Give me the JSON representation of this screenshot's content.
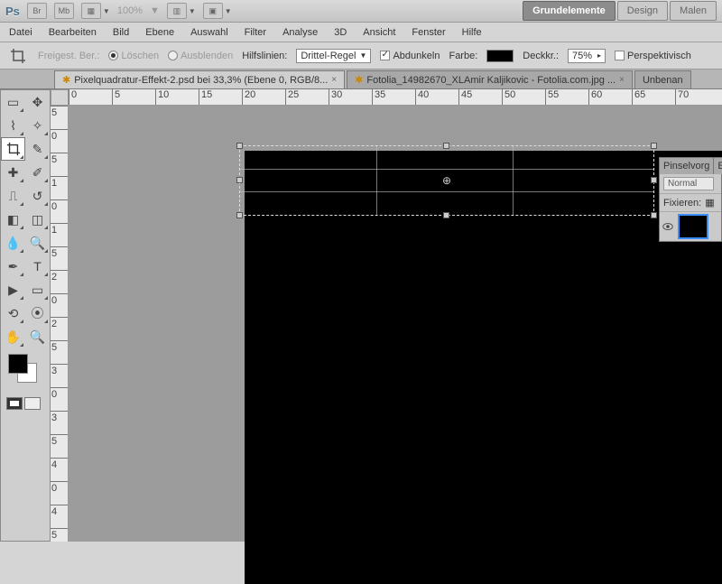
{
  "app": {
    "logo": "Ps"
  },
  "topbar": {
    "bridge": "Br",
    "mb": "Mb",
    "zoom": "100%"
  },
  "modes": {
    "grund": "Grundelemente",
    "design": "Design",
    "malen": "Malen"
  },
  "menu": [
    "Datei",
    "Bearbeiten",
    "Bild",
    "Ebene",
    "Auswahl",
    "Filter",
    "Analyse",
    "3D",
    "Ansicht",
    "Fenster",
    "Hilfe"
  ],
  "optbar": {
    "freigest": "Freigest. Ber.:",
    "loschen": "Löschen",
    "ausblenden": "Ausblenden",
    "hilfslinien": "Hilfslinien:",
    "guide_mode": "Drittel-Regel",
    "abdunkeln": "Abdunkeln",
    "farbe": "Farbe:",
    "deckk": "Deckkr.:",
    "deckk_val": "75%",
    "perspektivisch": "Perspektivisch"
  },
  "tabs": {
    "t1": "Pixelquadratur-Effekt-2.psd bei 33,3% (Ebene 0, RGB/8...",
    "t2": "Fotolia_14982670_XLAmir Kaljikovic - Fotolia.com.jpg ...",
    "t3": "Unbenan"
  },
  "ruler_h": [
    "0",
    "5",
    "10",
    "15",
    "20",
    "25",
    "30",
    "35",
    "40",
    "45",
    "50",
    "55",
    "60",
    "65",
    "70"
  ],
  "ruler_v": [
    "5",
    "0",
    "5",
    "1",
    "0",
    "1",
    "5",
    "2",
    "0",
    "2",
    "5",
    "3",
    "0",
    "3",
    "5",
    "4",
    "0",
    "4",
    "5"
  ],
  "panel": {
    "tab1": "Pinselvorg",
    "tab2": "Eb",
    "blend": "Normal",
    "fix": "Fixieren:"
  },
  "chart_data": null
}
